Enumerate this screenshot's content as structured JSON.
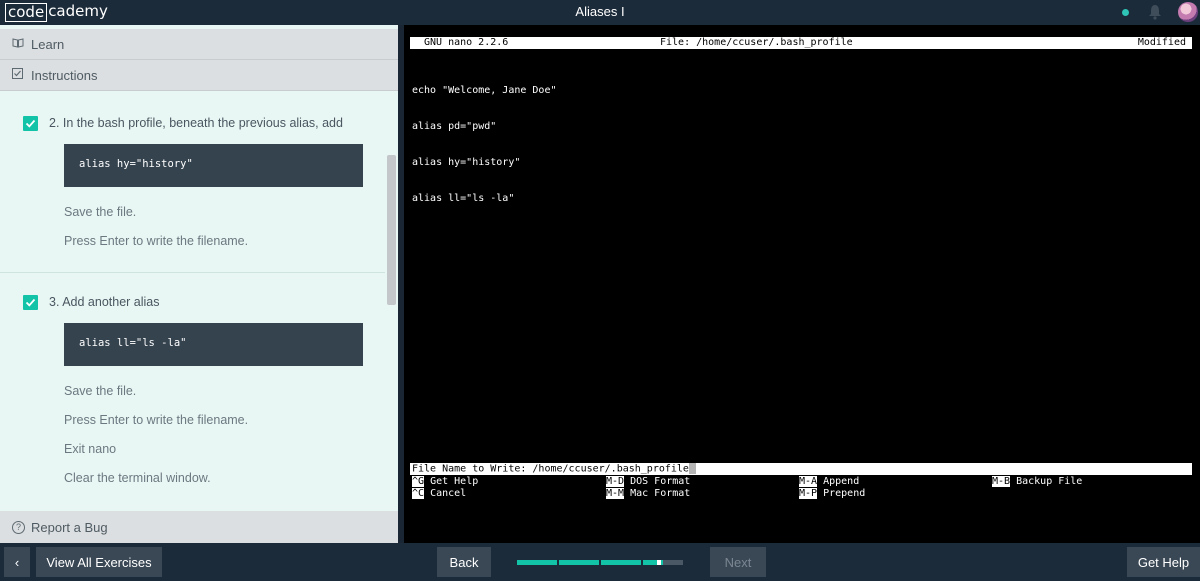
{
  "header": {
    "logo_left": "code",
    "logo_right": "cademy",
    "title": "Aliases I"
  },
  "sidebar": {
    "learn_label": "Learn",
    "instructions_label": "Instructions",
    "report_bug_label": "Report a Bug"
  },
  "steps": [
    {
      "title": "2. In the bash profile, beneath the previous alias, add",
      "code": "alias hy=\"history\"",
      "paragraphs": [
        "Save the file.",
        "Press Enter to write the filename."
      ],
      "checked": true
    },
    {
      "title": "3. Add another alias",
      "code": "alias ll=\"ls -la\"",
      "paragraphs": [
        "Save the file.",
        "Press Enter to write the filename.",
        "Exit nano",
        "Clear the terminal window."
      ],
      "checked": true
    }
  ],
  "terminal": {
    "app_version": "GNU nano 2.2.6",
    "file_header": "File: /home/ccuser/.bash_profile",
    "modified": "Modified",
    "lines": [
      "echo \"Welcome, Jane Doe\"",
      "alias pd=\"pwd\"",
      "alias hy=\"history\"",
      "alias ll=\"ls -la\""
    ],
    "prompt": "File Name to Write: /home/ccuser/.bash_profile",
    "shortcuts": [
      {
        "key": "^G",
        "label": "Get Help"
      },
      {
        "key": "^C",
        "label": "Cancel"
      },
      {
        "key": "M-D",
        "label": "DOS Format"
      },
      {
        "key": "M-M",
        "label": "Mac Format"
      },
      {
        "key": "M-A",
        "label": "Append"
      },
      {
        "key": "M-P",
        "label": "Prepend"
      },
      {
        "key": "M-B",
        "label": "Backup File"
      }
    ]
  },
  "footer": {
    "prev_icon": "chevron-left-icon",
    "prev_glyph": "‹",
    "view_all_label": "View All Exercises",
    "back_label": "Back",
    "next_label": "Next",
    "get_help_label": "Get Help",
    "progress": {
      "segments_total": 4,
      "segments_complete": 3,
      "current_segment_fraction": 0.5
    }
  },
  "colors": {
    "accent": "#12c3a8",
    "nav_bg": "#1c2b3a",
    "panel_bg": "#e9f7f4",
    "code_bg": "#35434f",
    "terminal_bg": "#000000"
  }
}
